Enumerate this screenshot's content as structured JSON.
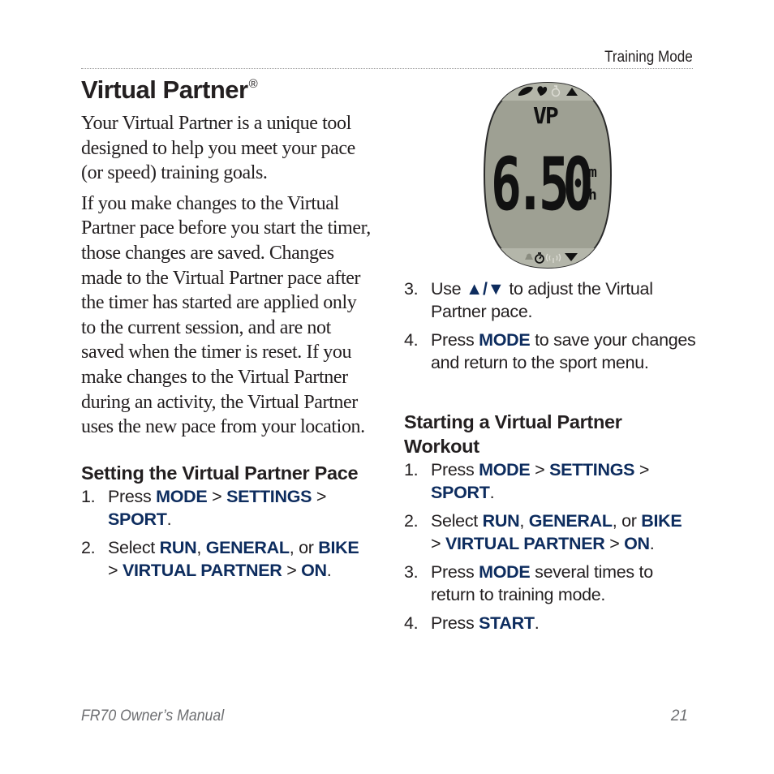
{
  "header": {
    "section": "Training Mode"
  },
  "title": {
    "text": "Virtual Partner",
    "mark": "®"
  },
  "intro": [
    "Your Virtual Partner is a unique tool designed to help you meet your pace (or speed) training goals.",
    "If you make changes to the Virtual Partner pace before you start the timer, those changes are saved. Changes made to the Virtual Partner pace after the timer has started are applied only to the current session, and are not saved when the timer is reset. If you make changes to the Virtual Partner during an activity, the Virtual Partner uses the new pace from your location."
  ],
  "setting_section": {
    "heading": "Setting the Virtual Partner Pace",
    "steps": [
      {
        "num": "1.",
        "parts": [
          [
            "Press ",
            false
          ],
          [
            "MODE",
            true
          ],
          [
            " > ",
            false
          ],
          [
            "SETTINGS",
            true
          ],
          [
            " > ",
            false
          ],
          [
            "SPORT",
            true
          ],
          [
            ".",
            false
          ]
        ]
      },
      {
        "num": "2.",
        "parts": [
          [
            "Select ",
            false
          ],
          [
            "RUN",
            true
          ],
          [
            ", ",
            false
          ],
          [
            "GENERAL",
            true
          ],
          [
            ", or ",
            false
          ],
          [
            "BIKE",
            true
          ],
          [
            " > ",
            false
          ],
          [
            "VIRTUAL PARTNER",
            true
          ],
          [
            " > ",
            false
          ],
          [
            "ON",
            true
          ],
          [
            ".",
            false
          ]
        ]
      },
      {
        "num": "3.",
        "parts": [
          [
            "Use ",
            false
          ],
          [
            "▲/▼",
            true
          ],
          [
            " to adjust the Virtual Partner pace.",
            false
          ]
        ]
      },
      {
        "num": "4.",
        "parts": [
          [
            "Press ",
            false
          ],
          [
            "MODE",
            true
          ],
          [
            " to save your changes and return to the sport menu.",
            false
          ]
        ]
      }
    ]
  },
  "starting_section": {
    "heading": "Starting a Virtual Partner Workout",
    "steps": [
      {
        "num": "1.",
        "parts": [
          [
            "Press ",
            false
          ],
          [
            "MODE",
            true
          ],
          [
            " > ",
            false
          ],
          [
            "SETTINGS",
            true
          ],
          [
            " > ",
            false
          ],
          [
            "SPORT",
            true
          ],
          [
            ".",
            false
          ]
        ]
      },
      {
        "num": "2.",
        "parts": [
          [
            "Select ",
            false
          ],
          [
            "RUN",
            true
          ],
          [
            ", ",
            false
          ],
          [
            "GENERAL",
            true
          ],
          [
            ", or ",
            false
          ],
          [
            "BIKE",
            true
          ],
          [
            " > ",
            false
          ],
          [
            "VIRTUAL PARTNER",
            true
          ],
          [
            " > ",
            false
          ],
          [
            "ON",
            true
          ],
          [
            ".",
            false
          ]
        ]
      },
      {
        "num": "3.",
        "parts": [
          [
            "Press ",
            false
          ],
          [
            "MODE",
            true
          ],
          [
            " several times to return to training mode.",
            false
          ]
        ]
      },
      {
        "num": "4.",
        "parts": [
          [
            "Press ",
            false
          ],
          [
            "START",
            true
          ],
          [
            ".",
            false
          ]
        ]
      }
    ]
  },
  "watch_screen": {
    "top_icons": [
      "shoe-icon",
      "heart-icon",
      "bike-icon",
      "up-arrow-icon"
    ],
    "bottom_icons": [
      "bell-icon",
      "stopwatch-icon",
      "signal-icon",
      "down-arrow-icon"
    ],
    "label": "VP",
    "value": "6.50",
    "unit_top": "m",
    "unit_bottom": "h"
  },
  "footer": {
    "manual": "FR70 Owner’s Manual",
    "page": "21"
  },
  "colors": {
    "keyword": "#0d2c5e",
    "text": "#231f20",
    "lcd": "#9ea093",
    "footer": "#6d6e71"
  }
}
